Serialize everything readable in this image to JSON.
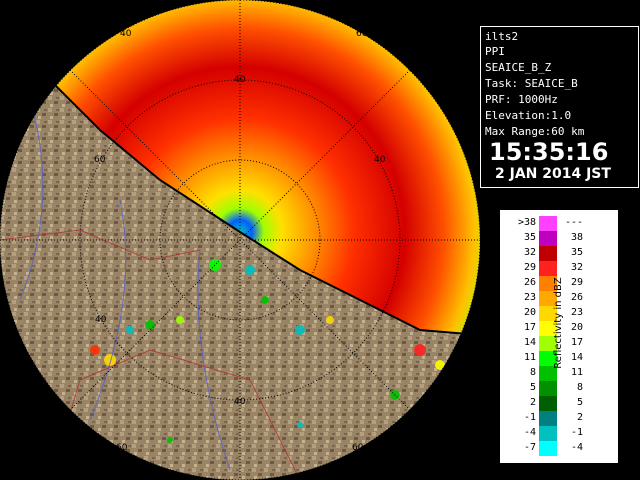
{
  "panel": {
    "radar_name": "ilts2",
    "scan_type": "PPI",
    "product": "SEAICE_B_Z",
    "task": "Task: SEAICE_B",
    "prf": "PRF: 1000Hz",
    "elevation": "Elevation:1.0",
    "max_range": "Max Range:60 km",
    "time": "15:35:16",
    "date": "2 JAN 2014 JST"
  },
  "legend": {
    "axis_label": "Reflectivity in dBZ",
    "entries": [
      {
        "min": ">38",
        "max": "---",
        "color": "#ff40ff"
      },
      {
        "min": "35",
        "max": "38",
        "color": "#c000c0"
      },
      {
        "min": "32",
        "max": "35",
        "color": "#c00000"
      },
      {
        "min": "29",
        "max": "32",
        "color": "#ff2020"
      },
      {
        "min": "26",
        "max": "29",
        "color": "#ff8000"
      },
      {
        "min": "23",
        "max": "26",
        "color": "#ffa800"
      },
      {
        "min": "20",
        "max": "23",
        "color": "#ffd800"
      },
      {
        "min": "17",
        "max": "20",
        "color": "#ffff00"
      },
      {
        "min": "14",
        "max": "17",
        "color": "#a0ff00"
      },
      {
        "min": "11",
        "max": "14",
        "color": "#00ff00"
      },
      {
        "min": "8",
        "max": "11",
        "color": "#00c000"
      },
      {
        "min": "5",
        "max": "8",
        "color": "#009000"
      },
      {
        "min": "2",
        "max": "5",
        "color": "#006000"
      },
      {
        "min": "-1",
        "max": "2",
        "color": "#008080"
      },
      {
        "min": "-4",
        "max": "-1",
        "color": "#00c0c0"
      },
      {
        "min": "-7",
        "max": "-4",
        "color": "#00ffff"
      }
    ]
  },
  "ring_labels": {
    "north_outer": "60",
    "north_inner": "40",
    "ne_outer": "60",
    "ne_inner": "40",
    "west_inner": "40",
    "sw_outer": "60",
    "south_inner": "40",
    "se_outer": "60",
    "nw_inner": "40"
  }
}
